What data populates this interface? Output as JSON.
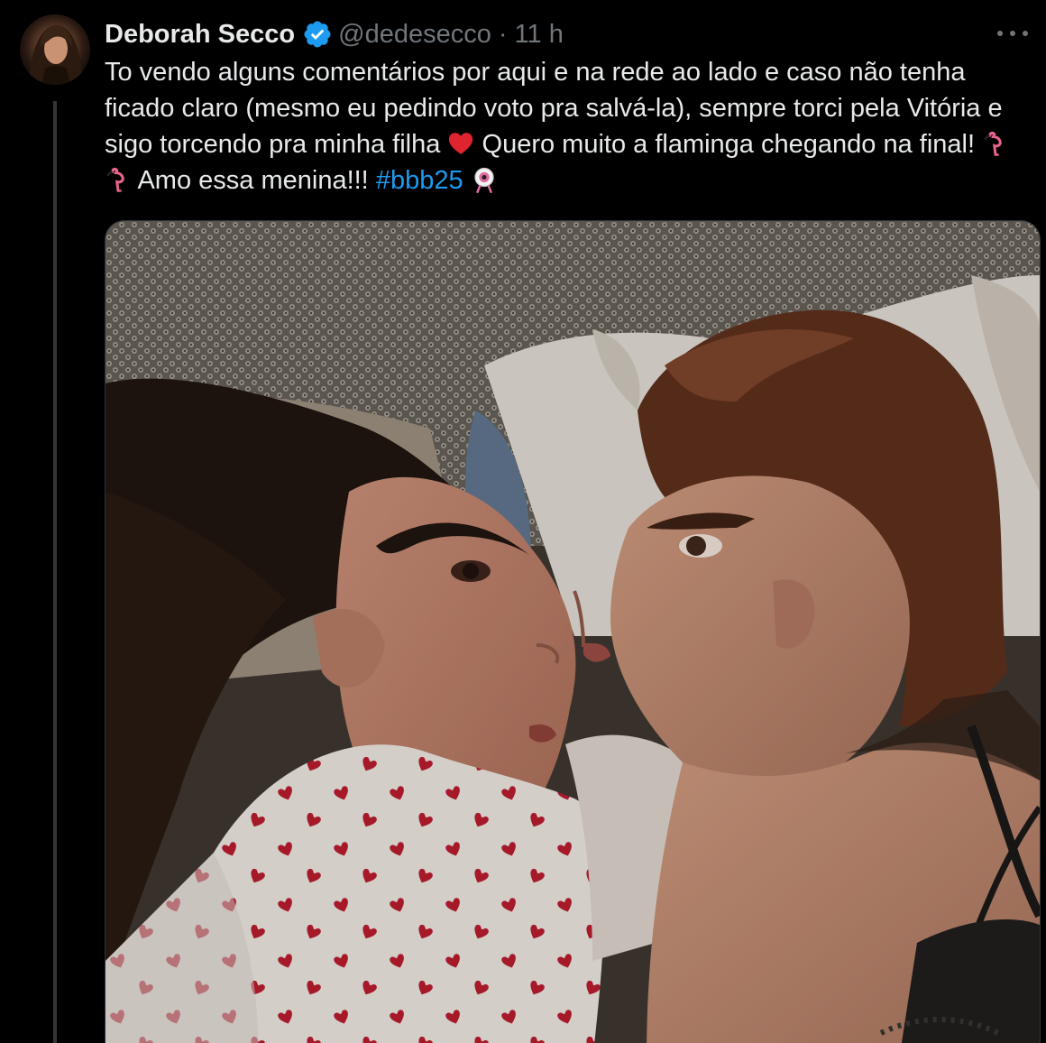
{
  "author": {
    "display_name": "Deborah Secco",
    "handle": "@dedesecco",
    "separator": "·",
    "time": "11 h"
  },
  "icons": {
    "verified": "verified-badge-icon",
    "more": "more-options-icon",
    "heart": "red-heart-emoji",
    "flamingo": "flamingo-emoji",
    "bbb": "bbb-eye-emoji"
  },
  "tweet": {
    "text_part1": "To vendo alguns comentários por aqui e na rede ao lado e caso não tenha ficado claro (mesmo eu pedindo voto pra salvá-la), sempre torci pela Vitória e sigo torcendo pra minha filha ",
    "text_part2": " Quero muito a flaminga chegando na final! ",
    "text_part3": " Amo essa menina!!! ",
    "hashtag": "#bbb25"
  },
  "colors": {
    "background": "#000000",
    "text": "#e7e9ea",
    "secondary": "#71767b",
    "link": "#1d9bf0",
    "verified": "#1d9bf0"
  }
}
